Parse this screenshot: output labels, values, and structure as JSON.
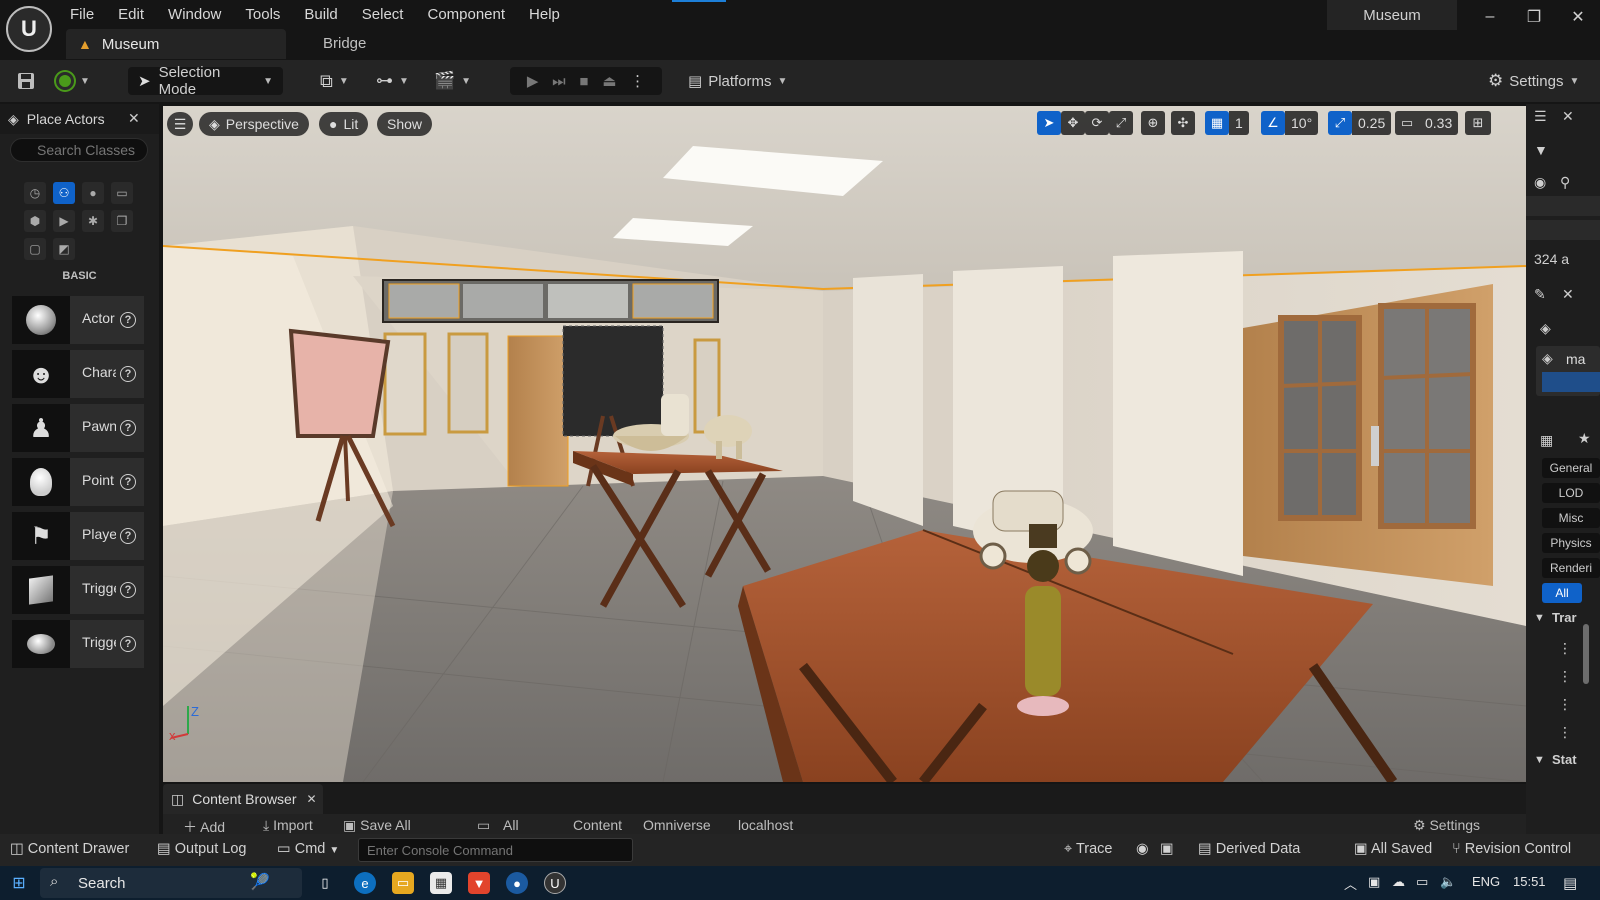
{
  "app": {
    "logo": "U",
    "project_name": "Museum",
    "menu": [
      "File",
      "Edit",
      "Window",
      "Tools",
      "Build",
      "Select",
      "Component",
      "Help"
    ],
    "tabs": {
      "level": "Museum",
      "bridge": "Bridge"
    },
    "window_controls": {
      "minimize": "–",
      "restore": "❐",
      "close": "✕"
    }
  },
  "toolbar": {
    "selection_mode": "Selection Mode",
    "platforms": "Platforms",
    "settings": "Settings",
    "icons": [
      "save-icon",
      "source-control-icon",
      "add-actor-icon",
      "blueprint-icon",
      "cinematics-icon",
      "play-icon",
      "advance-frame-icon",
      "stop-icon",
      "eject-icon",
      "more-options-icon"
    ]
  },
  "place_actors": {
    "title": "Place Actors",
    "close": "✕",
    "search_placeholder": "Search Classes",
    "category_label": "BASIC",
    "items": [
      {
        "label": "Actor",
        "icon": "sphere-icon"
      },
      {
        "label": "Character",
        "icon": "character-icon"
      },
      {
        "label": "Pawn",
        "icon": "pawn-icon"
      },
      {
        "label": "Point Light",
        "icon": "light-bulb-icon"
      },
      {
        "label": "Player Start",
        "icon": "player-start-icon"
      },
      {
        "label": "Trigger Box",
        "icon": "trigger-box-icon"
      },
      {
        "label": "Trigger Sphere",
        "icon": "trigger-sphere-icon"
      }
    ]
  },
  "viewport": {
    "view_mode": "Perspective",
    "lighting": "Lit",
    "show": "Show",
    "grid_snap": "1",
    "rotation_snap": "10°",
    "scale_snap": "0.25",
    "camera_speed": "0.33",
    "axis_labels": {
      "z": "Z",
      "x": "x"
    },
    "accent_color": "#0f62c9",
    "selection_color": "#f0a020"
  },
  "details_panel": {
    "count_text": "324 a",
    "actor_name": "ma",
    "tabs": [
      "General",
      "LOD",
      "Misc",
      "Physics",
      "Renderi",
      "All"
    ],
    "sections": [
      "Trar",
      "Stat"
    ]
  },
  "content_browser": {
    "title": "Content Browser",
    "close": "✕",
    "strip": {
      "add": "Add",
      "import": "Import",
      "save_all": "Save All",
      "path": [
        "All",
        "Content",
        "Omniverse",
        "localhost"
      ],
      "settings": "Settings"
    }
  },
  "status_bar": {
    "content_drawer": "Content Drawer",
    "output_log": "Output Log",
    "cmd": "Cmd",
    "console_placeholder": "Enter Console Command",
    "trace": "Trace",
    "derived_data": "Derived Data",
    "all_saved": "All Saved",
    "revision_control": "Revision Control"
  },
  "taskbar": {
    "search": "Search",
    "language": "ENG",
    "time": "15:51"
  }
}
